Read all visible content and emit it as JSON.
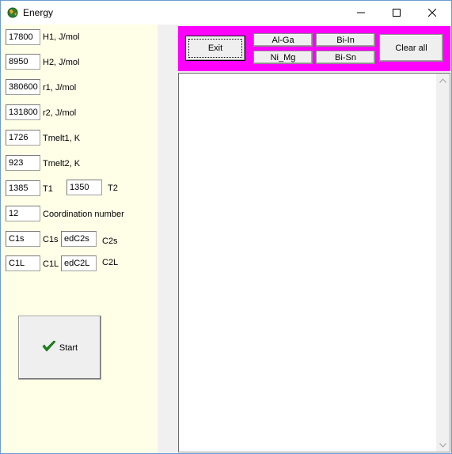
{
  "window": {
    "title": "Energy",
    "icon": "app-globe-icon",
    "controls": {
      "minimize_icon": "minimize-icon",
      "maximize_icon": "maximize-icon",
      "close_icon": "close-icon"
    }
  },
  "params": {
    "h1": {
      "value": "17800",
      "label": "H1, J/mol"
    },
    "h2": {
      "value": "8950",
      "label": "H2, J/mol"
    },
    "r1": {
      "value": "380600",
      "label": "r1, J/mol"
    },
    "r2": {
      "value": "131800",
      "label": "r2, J/mol"
    },
    "tmelt1": {
      "value": "1726",
      "label": "Tmelt1, K"
    },
    "tmelt2": {
      "value": "923",
      "label": "Tmelt2, K"
    },
    "t1": {
      "value": "1385",
      "label": "T1"
    },
    "t2": {
      "value": "1350",
      "label": "T2"
    },
    "coord": {
      "value": "12",
      "label": "Coordination number"
    },
    "c1s": {
      "value": "C1s",
      "label": "C1s"
    },
    "c2s": {
      "value": "edC2s",
      "label": "C2s"
    },
    "c1l": {
      "value": "C1L",
      "label": "C1L"
    },
    "c2l": {
      "value": "edC2L",
      "label": "C2L"
    }
  },
  "start": {
    "label": "Start",
    "icon": "checkmark-icon"
  },
  "toolbar": {
    "exit_label": "Exit",
    "al_ga_label": "Al-Ga",
    "ni_mg_label": "Ni_Mg",
    "bi_in_label": "Bi-In",
    "bi_sn_label": "Bi-Sn",
    "clear_all_label": "Clear all"
  },
  "colors": {
    "left_panel_bg": "#ffffe8",
    "toolbar_bg": "#ff00ff",
    "checkmark": "#1a8a1a"
  }
}
